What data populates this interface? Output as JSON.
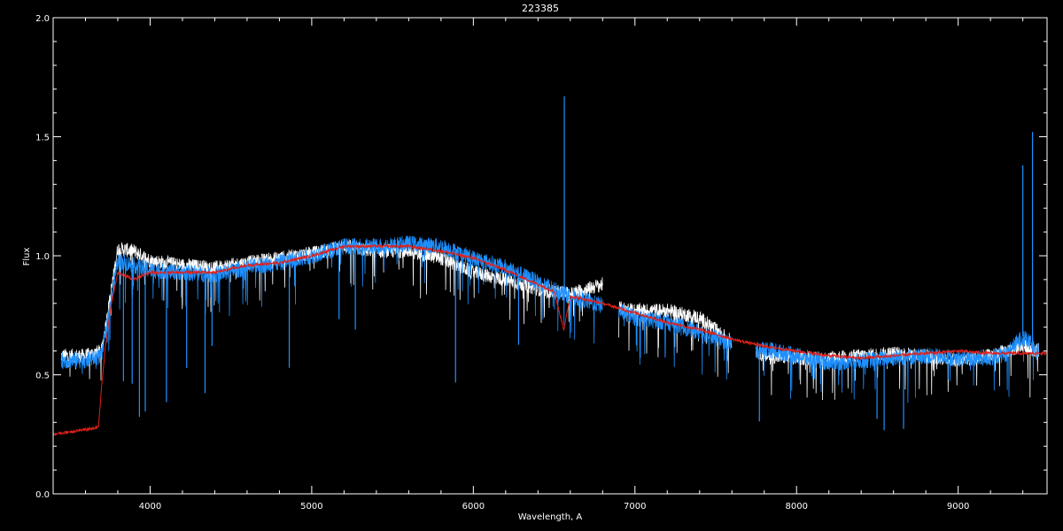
{
  "chart_data": {
    "type": "line",
    "title": "223385",
    "xlabel": "Wavelength, A",
    "ylabel": "Flux",
    "xlim": [
      3400,
      9550
    ],
    "ylim": [
      0.0,
      2.0
    ],
    "x_ticks": [
      4000,
      5000,
      6000,
      7000,
      8000,
      9000
    ],
    "y_ticks": [
      0.0,
      0.5,
      1.0,
      1.5,
      2.0
    ],
    "y_tick_labels": [
      "0.0",
      "0.5",
      "1.0",
      "1.5",
      "2.0"
    ],
    "grid": false,
    "legend": "none",
    "colors": {
      "background": "#000000",
      "axes": "#ffffff",
      "white_series": "#ffffff",
      "blue_series": "#1e90ff",
      "red_series": "#e0201a"
    },
    "series": [
      {
        "color": "white",
        "x": [
          3450,
          3600,
          3700,
          3800,
          3900,
          4000,
          4200,
          4400,
          4600,
          4800,
          5000,
          5200,
          5400,
          5600,
          5800,
          6000,
          6200,
          6400,
          6600,
          6800
        ],
        "y": [
          0.58,
          0.58,
          0.6,
          1.03,
          1.02,
          0.98,
          0.96,
          0.95,
          0.97,
          0.99,
          1.01,
          1.04,
          1.02,
          1.02,
          0.99,
          0.93,
          0.9,
          0.86,
          0.84,
          0.88
        ]
      },
      {
        "color": "white",
        "x": [
          6900,
          7000,
          7200,
          7400,
          7600
        ],
        "y": [
          0.78,
          0.77,
          0.77,
          0.74,
          0.64
        ]
      },
      {
        "color": "white",
        "x": [
          7750,
          7800,
          8000,
          8200,
          8400,
          8600,
          8800,
          9000,
          9200,
          9400,
          9500
        ],
        "y": [
          0.6,
          0.58,
          0.57,
          0.57,
          0.58,
          0.59,
          0.58,
          0.56,
          0.58,
          0.62,
          0.6
        ]
      },
      {
        "color": "blue",
        "x": [
          3450,
          3600,
          3700,
          3800,
          3900,
          4000,
          4200,
          4400,
          4600,
          4800,
          5000,
          5200,
          5400,
          5600,
          5800,
          6000,
          6200,
          6400,
          6600,
          6800
        ],
        "y": [
          0.56,
          0.56,
          0.58,
          0.98,
          0.96,
          0.94,
          0.93,
          0.92,
          0.95,
          0.97,
          1.0,
          1.04,
          1.04,
          1.05,
          1.04,
          0.99,
          0.95,
          0.89,
          0.83,
          0.79
        ]
      },
      {
        "color": "blue",
        "x": [
          6900,
          7000,
          7200,
          7400,
          7600
        ],
        "y": [
          0.77,
          0.74,
          0.72,
          0.68,
          0.63
        ]
      },
      {
        "color": "blue",
        "x": [
          7750,
          7800,
          8000,
          8200,
          8400,
          8600,
          8800,
          9000,
          9200,
          9300,
          9400,
          9500
        ],
        "y": [
          0.6,
          0.61,
          0.58,
          0.55,
          0.56,
          0.57,
          0.58,
          0.57,
          0.57,
          0.59,
          0.66,
          0.6
        ]
      },
      {
        "color": "red",
        "x": [
          3400,
          3500,
          3600,
          3680,
          3700,
          3720,
          3760,
          3800,
          3900,
          4000,
          4200,
          4400,
          4600,
          4800,
          5000,
          5200,
          5400,
          5600,
          5800,
          6000,
          6200,
          6400,
          6500,
          6560,
          6600,
          6800,
          7000,
          7200,
          7400,
          7600,
          7800,
          8000,
          8200,
          8400,
          8600,
          8800,
          9000,
          9200,
          9400,
          9550
        ],
        "y": [
          0.25,
          0.26,
          0.27,
          0.28,
          0.45,
          0.6,
          0.8,
          0.93,
          0.9,
          0.93,
          0.93,
          0.93,
          0.96,
          0.97,
          1.0,
          1.04,
          1.04,
          1.04,
          1.02,
          0.99,
          0.94,
          0.88,
          0.85,
          0.69,
          0.83,
          0.8,
          0.76,
          0.72,
          0.69,
          0.65,
          0.62,
          0.6,
          0.58,
          0.57,
          0.58,
          0.59,
          0.6,
          0.59,
          0.59,
          0.59
        ]
      }
    ],
    "absorption_lines": [
      {
        "x": 3835,
        "depth": 0.5
      },
      {
        "x": 3889,
        "depth": 0.5
      },
      {
        "x": 3934,
        "depth": 0.63
      },
      {
        "x": 3970,
        "depth": 0.6
      },
      {
        "x": 4101,
        "depth": 0.55
      },
      {
        "x": 4226,
        "depth": 0.4
      },
      {
        "x": 4340,
        "depth": 0.5
      },
      {
        "x": 4383,
        "depth": 0.3
      },
      {
        "x": 4861,
        "depth": 0.45
      },
      {
        "x": 5169,
        "depth": 0.3
      },
      {
        "x": 5270,
        "depth": 0.35
      },
      {
        "x": 5890,
        "depth": 0.55
      },
      {
        "x": 6280,
        "depth": 0.3
      },
      {
        "x": 6870,
        "depth": 0.2
      },
      {
        "x": 7770,
        "depth": 0.3
      },
      {
        "x": 8498,
        "depth": 0.25
      },
      {
        "x": 8542,
        "depth": 0.3
      },
      {
        "x": 8662,
        "depth": 0.3
      }
    ],
    "emission_lines": [
      {
        "x": 6563,
        "peak": 1.67
      },
      {
        "x": 9400,
        "peak": 1.38
      },
      {
        "x": 9460,
        "peak": 1.52
      }
    ]
  }
}
